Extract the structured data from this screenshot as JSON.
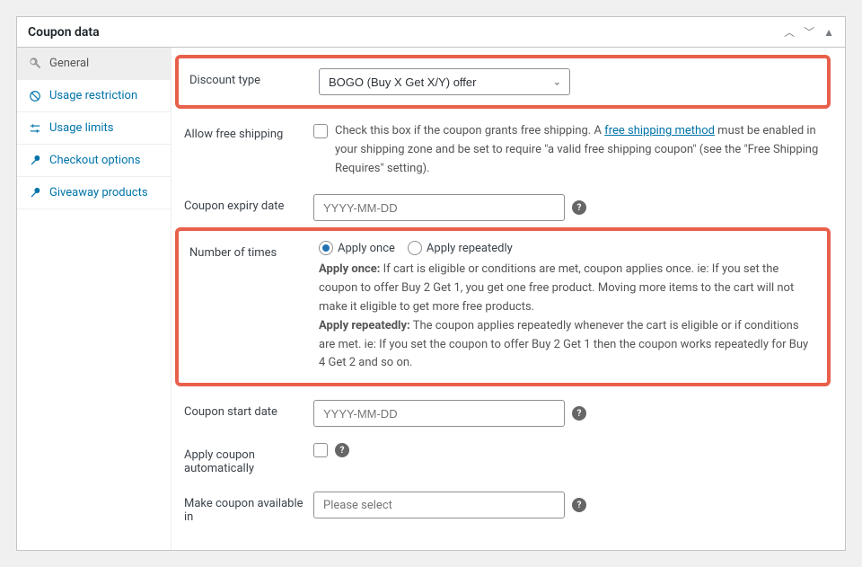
{
  "panel": {
    "title": "Coupon data"
  },
  "tabs": {
    "general": "General",
    "usage_restriction": "Usage restriction",
    "usage_limits": "Usage limits",
    "checkout_options": "Checkout options",
    "giveaway_products": "Giveaway products"
  },
  "fields": {
    "discount_type": {
      "label": "Discount type",
      "value": "BOGO (Buy X Get X/Y) offer"
    },
    "free_shipping": {
      "label": "Allow free shipping",
      "desc_prefix": "Check this box if the coupon grants free shipping. A ",
      "link_text": "free shipping method",
      "desc_suffix": " must be enabled in your shipping zone and be set to require \"a valid free shipping coupon\" (see the \"Free Shipping Requires\" setting)."
    },
    "expiry": {
      "label": "Coupon expiry date",
      "placeholder": "YYYY-MM-DD"
    },
    "number_of_times": {
      "label": "Number of times",
      "opt_once": "Apply once",
      "opt_repeat": "Apply repeatedly",
      "desc_once_label": "Apply once:",
      "desc_once": " If cart is eligible or conditions are met, coupon applies once. ie: If you set the coupon to offer Buy 2 Get 1, you get one free product. Moving more items to the cart will not make it eligible to get more free products.",
      "desc_repeat_label": "Apply repeatedly:",
      "desc_repeat": " The coupon applies repeatedly whenever the cart is eligible or if conditions are met. ie: If you set the coupon to offer Buy 2 Get 1 then the coupon works repeatedly for Buy 4 Get 2 and so on."
    },
    "start_date": {
      "label": "Coupon start date",
      "placeholder": "YYYY-MM-DD"
    },
    "apply_auto": {
      "label": "Apply coupon automatically"
    },
    "available_in": {
      "label": "Make coupon available in",
      "placeholder": "Please select"
    }
  }
}
